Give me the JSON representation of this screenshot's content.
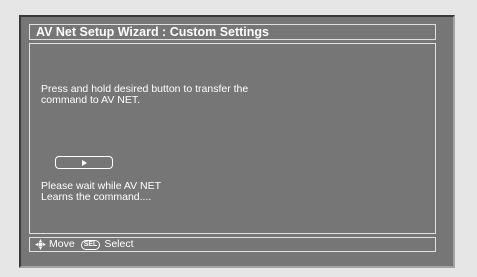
{
  "window": {
    "title": "AV Net Setup Wizard : Custom Settings"
  },
  "content": {
    "instruction": "Press and hold desired button to transfer the\ncommand to AV NET.",
    "status": "Please wait while AV NET\nLearns the command...."
  },
  "play_button": {
    "icon": "play-icon"
  },
  "footer": {
    "move_icon": "dpad-icon",
    "move_label": "Move",
    "select_key": "SEL",
    "select_label": "Select"
  },
  "colors": {
    "background": "#e6e6e6",
    "screen": "#767676",
    "border": "#e0e0e0",
    "text": "#ffffff"
  }
}
